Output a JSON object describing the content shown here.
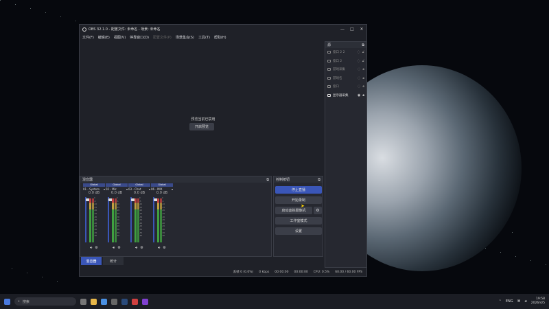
{
  "window": {
    "title": "OBS 32.1.0 - 配置文件: 未命名 - 场景: 未命名",
    "controls": {
      "minimize": "—",
      "maximize": "□",
      "close": "✕"
    }
  },
  "menu": [
    {
      "label": "文件(F)",
      "disabled": false
    },
    {
      "label": "编辑(E)",
      "disabled": false
    },
    {
      "label": "视图(V)",
      "disabled": false
    },
    {
      "label": "停靠窗口(D)",
      "disabled": false
    },
    {
      "label": "配置文件(P)",
      "disabled": true
    },
    {
      "label": "场景集合(S)",
      "disabled": false
    },
    {
      "label": "工具(T)",
      "disabled": false
    },
    {
      "label": "帮助(H)",
      "disabled": false
    }
  ],
  "preview": {
    "message": "预览当前已禁用",
    "button": "开启预览"
  },
  "sources": {
    "header": "源",
    "items": [
      {
        "label": "窗口 2 2",
        "icon": "window-icon",
        "active": false
      },
      {
        "label": "窗口 2",
        "icon": "window-icon",
        "active": false
      },
      {
        "label": "游戏采集",
        "icon": "gamepad-icon",
        "active": false
      },
      {
        "label": "游戏名",
        "icon": "gamepad-icon",
        "active": false
      },
      {
        "label": "窗口",
        "icon": "window-icon",
        "active": false
      },
      {
        "label": "显示器采集",
        "icon": "monitor-icon",
        "active": true
      }
    ]
  },
  "mixer": {
    "header": "混音器",
    "channels": [
      {
        "global": "Global",
        "name": "01 - System",
        "db": "0.0 dB"
      },
      {
        "global": "Global",
        "name": "02 - Mic",
        "db": "0.0 dB"
      },
      {
        "global": "Global",
        "name": "03 - Chat",
        "db": "0.0 dB"
      },
      {
        "global": "Global",
        "name": "06 - MIX",
        "db": "0.0 dB"
      }
    ],
    "scale": [
      "0",
      "-5",
      "-10",
      "-15",
      "-20",
      "-25",
      "-30",
      "-35",
      "-40",
      "-45",
      "-50",
      "-55",
      "-60"
    ]
  },
  "controls": {
    "header": "控制按钮",
    "stop_stream": "停止直播",
    "start_record": "开始录制",
    "virtual_cam": "启动虚拟摄像机",
    "studio_mode": "工作室模式",
    "settings": "设置"
  },
  "tabs": [
    {
      "label": "混音器",
      "active": true
    },
    {
      "label": "统计",
      "active": false
    }
  ],
  "status": {
    "dropped": "丢帧 0 (0.0%)",
    "bitrate": "0 kbps",
    "stream_time": "00:00:00",
    "record_time": "00:00:00",
    "cpu": "CPU: 0.5%",
    "fps": "60.00 / 60.00 FPS"
  },
  "taskbar": {
    "search_placeholder": "搜索",
    "lang": "ENG",
    "time": "19:58",
    "date": "2026/4/5"
  },
  "colors": {
    "accent": "#3a56b8",
    "panel": "#262830",
    "bg": "#1f2128"
  }
}
